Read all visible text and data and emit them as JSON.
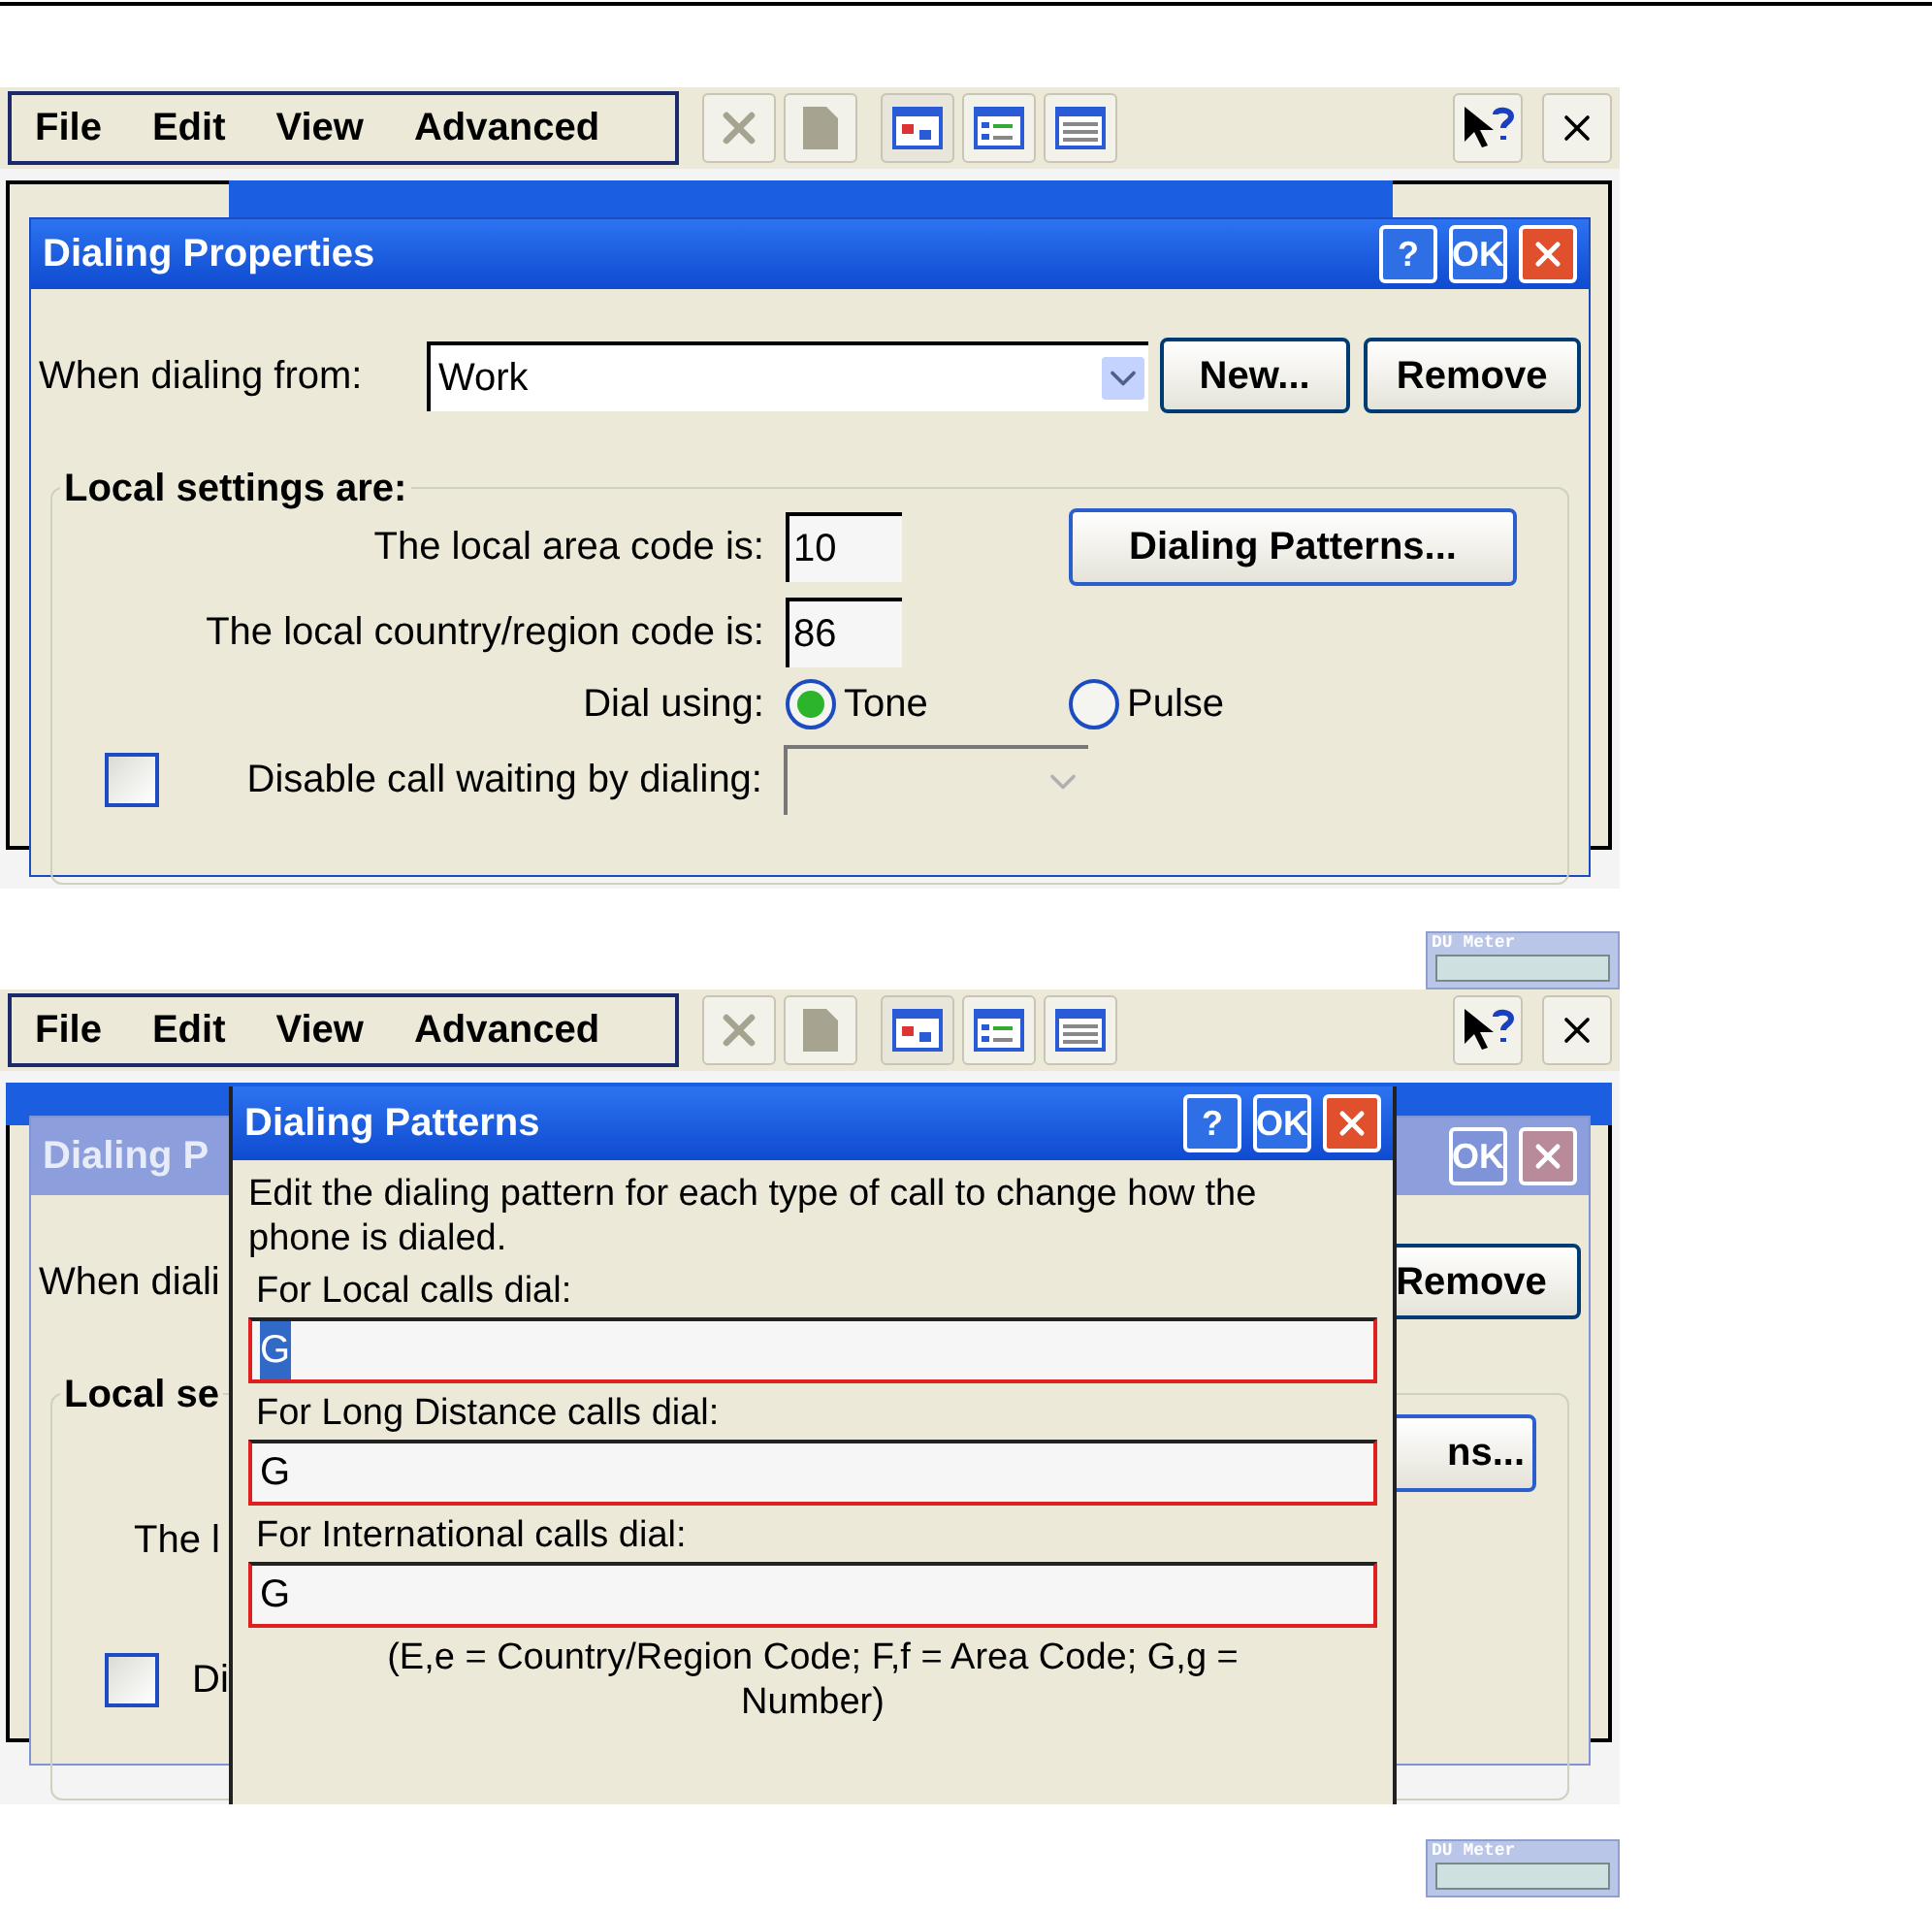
{
  "screenshot_1": {
    "menu_bar": [
      "File",
      "Edit",
      "View",
      "Advanced"
    ],
    "dialog": {
      "title": "Dialing Properties",
      "title_buttons": [
        "?",
        "OK"
      ],
      "dialing_from": {
        "label": "When dialing from:",
        "value": "Work"
      },
      "buttons": [
        "New...",
        "Remove"
      ],
      "group": "Local settings are:",
      "area_code": {
        "label": "The local area code is:",
        "value": "10"
      },
      "patterns_button": "Dialing Patterns...",
      "country_code": {
        "label": "The local country/region code is:",
        "value": "86"
      },
      "dial_using": {
        "label": "Dial using:",
        "options": [
          {
            "label": "Tone",
            "selected": true
          },
          {
            "label": "Pulse",
            "selected": false
          }
        ]
      },
      "call_waiting": {
        "label": "Disable call waiting by dialing:",
        "checked": false
      }
    }
  },
  "widget_1": {
    "title": "DU Meter"
  },
  "screenshot_2": {
    "menu_bar": [
      "File",
      "Edit",
      "View",
      "Advanced"
    ],
    "background_window": {
      "title": "Dialing P",
      "title_button": "OK",
      "label": "When diali",
      "remove": "Remove",
      "group": "Local se",
      "patterns_button": "ns...",
      "country_label": "The l",
      "checkbox_label": "Di",
      "checked": false
    },
    "dialog": {
      "title": "Dialing Patterns",
      "title_buttons": [
        "?",
        "OK"
      ],
      "description": "Edit the dialing pattern for each type of call to change how the phone is dialed.",
      "fields": [
        {
          "label": "For Local calls dial:",
          "value": "G",
          "selected": true
        },
        {
          "label": "For Long Distance calls dial:",
          "value": "G",
          "selected": false
        },
        {
          "label": "For International calls dial:",
          "value": "G",
          "selected": false
        }
      ],
      "note": "(E,e = Country/Region Code; F,f = Area Code; G,g = Number)"
    }
  },
  "widget_2": {
    "title": "DU Meter"
  }
}
